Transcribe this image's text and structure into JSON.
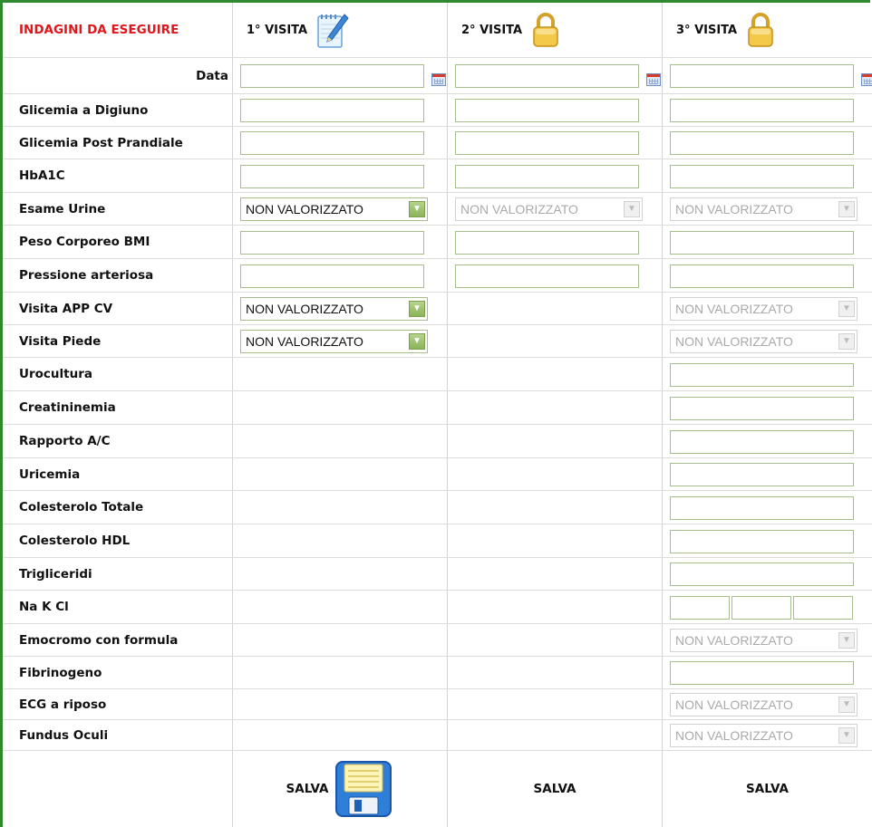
{
  "header": {
    "title": "INDAGINI DA ESEGUIRE",
    "visits": [
      {
        "label": "1° VISITA",
        "icon": "edit-notepad-icon"
      },
      {
        "label": "2° VISITA",
        "icon": "lock-icon"
      },
      {
        "label": "3° VISITA",
        "icon": "lock-icon"
      }
    ]
  },
  "rows": {
    "data": "Data",
    "glicemia_digiuno": "Glicemia a Digiuno",
    "glicemia_post": "Glicemia Post Prandiale",
    "hba1c": "HbA1C",
    "esame_urine": "Esame Urine",
    "peso_bmi": "Peso Corporeo BMI",
    "pressione": "Pressione arteriosa",
    "visita_app_cv": "Visita APP CV",
    "visita_piede": "Visita Piede",
    "urocultura": "Urocultura",
    "creatininemia": "Creatininemia",
    "rapporto_ac": "Rapporto A/C",
    "uricemia": "Uricemia",
    "colesterolo_totale": "Colesterolo Totale",
    "colesterolo_hdl": "Colesterolo HDL",
    "trigliceridi": "Trigliceridi",
    "na_k_cl": "Na K Cl",
    "emocromo": "Emocromo con formula",
    "fibrinogeno": "Fibrinogeno",
    "ecg": "ECG a riposo",
    "fundus": "Fundus Oculi"
  },
  "select_value": "NON VALORIZZATO",
  "footer": {
    "save_label": "SALVA"
  },
  "colors": {
    "frame_green": "#2f8a2f",
    "title_red": "#e0161c",
    "field_border": "#a6bf8a"
  }
}
